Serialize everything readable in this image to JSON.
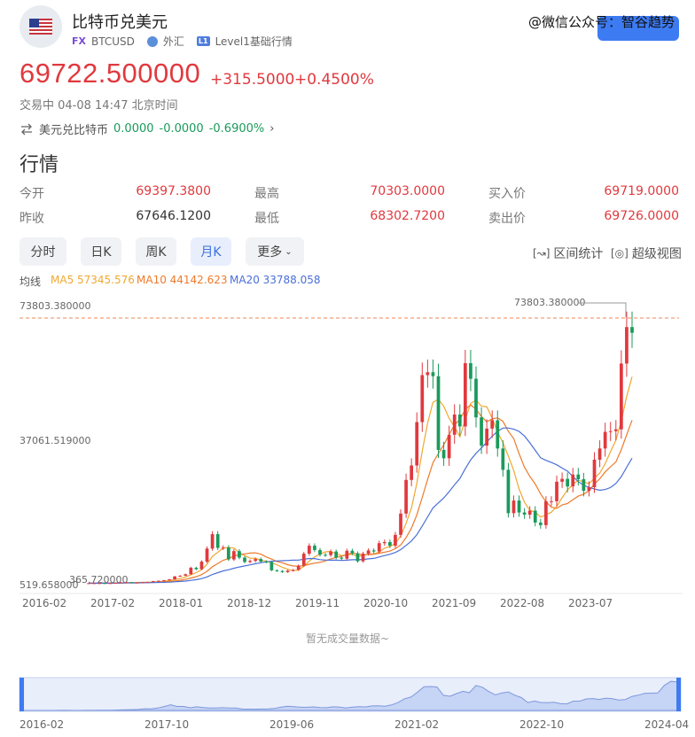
{
  "header": {
    "title": "比特币兑美元",
    "fx_badge": "FX",
    "symbol": "BTCUSD",
    "market": "外汇",
    "l1_badge": "L1",
    "quote_level": "Level1基础行情",
    "watermark": "@微信公众号：智谷趋势"
  },
  "quote": {
    "price": "69722.500000",
    "change": "+315.5000",
    "change_pct": "+0.4500%",
    "status": "交易中 04-08 14:47 北京时间",
    "reverse_label": "美元兑比特币",
    "reverse_price": "0.0000",
    "reverse_change": "-0.0000",
    "reverse_pct": "-0.6900%"
  },
  "section_title": "行情",
  "stats": {
    "open_label": "今开",
    "open": "69397.3800",
    "prev_label": "昨收",
    "prev": "67646.1200",
    "high_label": "最高",
    "high": "70303.0000",
    "low_label": "最低",
    "low": "68302.7200",
    "bid_label": "买入价",
    "bid": "69719.0000",
    "ask_label": "卖出价",
    "ask": "69726.0000"
  },
  "tabs": [
    "分时",
    "日K",
    "周K",
    "月K",
    "更多"
  ],
  "tools": {
    "range_stats": "区间统计",
    "super_view": "超级视图"
  },
  "ma": {
    "label": "均线",
    "ma5": "MA5 57345.576",
    "ma10": "MA10 44142.623",
    "ma20": "MA20 33788.058"
  },
  "colors": {
    "up": "#e0393e",
    "down": "#1a9a5b",
    "ma5": "#f0a830",
    "ma10": "#ee7a2a",
    "ma20": "#4a6fd8",
    "accent": "#3d7bf2"
  },
  "chart_data": {
    "type": "candlestick",
    "y_labels": [
      "73803.380000",
      "37061.519000",
      "519.658000"
    ],
    "max_annotation": "73803.380000",
    "min_annotation": "365.720000",
    "x_ticks": [
      "2016-02",
      "2017-02",
      "2018-01",
      "2018-12",
      "2019-11",
      "2020-10",
      "2021-09",
      "2022-08",
      "2023-07"
    ],
    "ylim": [
      519.658,
      73803.38
    ],
    "closes": [
      430,
      430,
      440,
      420,
      450,
      530,
      670,
      700,
      620,
      620,
      700,
      780,
      1000,
      1100,
      1250,
      1500,
      2300,
      2500,
      2900,
      4700,
      4300,
      6400,
      10000,
      14000,
      10200,
      10300,
      7000,
      9300,
      7500,
      6300,
      6600,
      7100,
      6400,
      6300,
      4000,
      3800,
      3500,
      3900,
      4100,
      5300,
      8600,
      10800,
      9600,
      8300,
      8200,
      9200,
      7500,
      7200,
      9400,
      8700,
      6500,
      8600,
      9500,
      9200,
      11500,
      11800,
      10800,
      13800,
      19700,
      29000,
      33000,
      45000,
      58000,
      58800,
      57700,
      37300,
      35000,
      41500,
      47100,
      43800,
      61300,
      57000,
      46300,
      38500,
      43200,
      45500,
      37700,
      31800,
      19800,
      23300,
      20000,
      19400,
      20500,
      17200,
      16500,
      23100,
      23100,
      28500,
      29300,
      27200,
      30500,
      29200,
      26000,
      27000,
      34600,
      37700,
      42300,
      42500,
      43000,
      61200,
      71300,
      69722
    ]
  },
  "navigator": {
    "x_ticks": [
      "2016-02",
      "2017-10",
      "2019-06",
      "2021-02",
      "2022-10",
      "2024-04"
    ]
  },
  "empty_volume": "暂无成交量数据~"
}
